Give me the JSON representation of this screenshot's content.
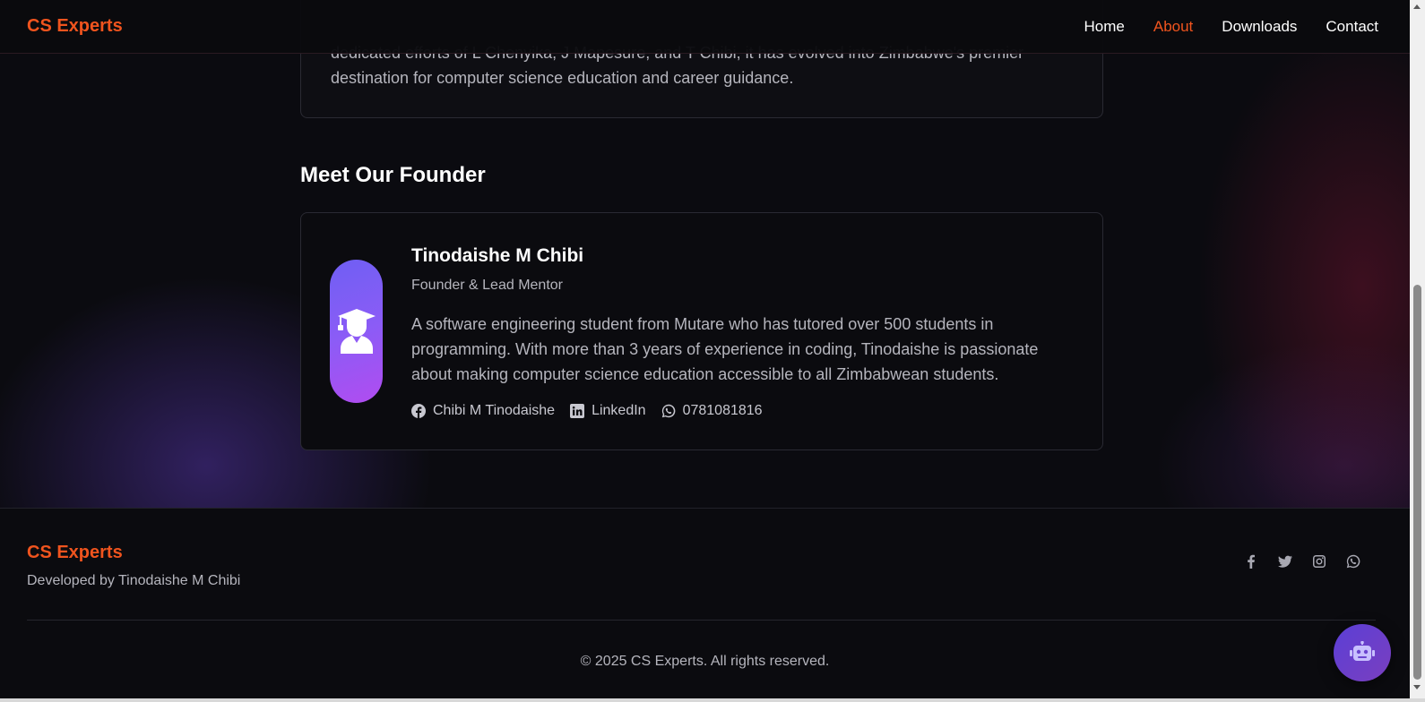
{
  "nav": {
    "brand": "CS Experts",
    "links": [
      {
        "label": "Home"
      },
      {
        "label": "About"
      },
      {
        "label": "Downloads"
      },
      {
        "label": "Contact"
      }
    ],
    "active": "About"
  },
  "story": {
    "text": "dedicated efforts of L Chenyika, J Mapesure, and T Chibi, it has evolved into Zimbabwe's premier destination for computer science education and career guidance."
  },
  "founder_section": {
    "title": "Meet Our Founder",
    "name": "Tinodaishe M Chibi",
    "role": "Founder & Lead Mentor",
    "bio": "A software engineering student from Mutare who has tutored over 500 students in programming. With more than 3 years of experience in coding, Tinodaishe is passionate about making computer science education accessible to all Zimbabwean students.",
    "avatar_icon": "graduate-icon",
    "links": [
      {
        "icon": "facebook-icon",
        "label": "Chibi M Tinodaishe"
      },
      {
        "icon": "linkedin-icon",
        "label": "LinkedIn"
      },
      {
        "icon": "whatsapp-icon",
        "label": "0781081816"
      }
    ]
  },
  "footer": {
    "brand": "CS Experts",
    "developer": "Developed by Tinodaishe M Chibi",
    "social_icons": [
      "facebook-icon",
      "twitter-icon",
      "instagram-icon",
      "whatsapp-icon"
    ],
    "copyright": "© 2025 CS Experts. All rights reserved."
  },
  "chat_widget": {
    "icon": "robot-icon"
  },
  "colors": {
    "accent": "#f0541e",
    "background": "#0b0b0f",
    "avatar_gradient_start": "#6f5ff3",
    "avatar_gradient_end": "#b14cf0"
  }
}
